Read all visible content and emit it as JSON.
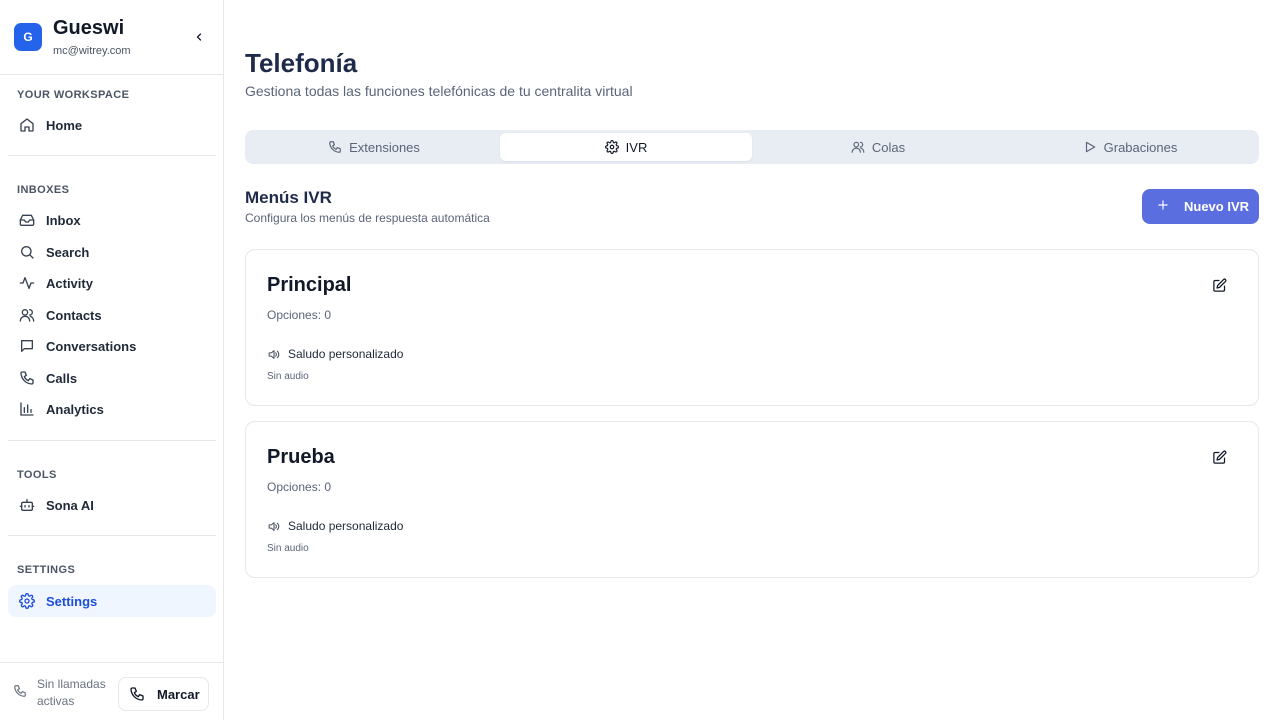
{
  "workspace": {
    "avatar_letter": "G",
    "name": "Gueswi",
    "email": "mc@witrey.com"
  },
  "sidebar": {
    "workspace_label": "YOUR WORKSPACE",
    "home": "Home",
    "inboxes_label": "INBOXES",
    "inboxes": [
      {
        "label": "Inbox",
        "icon": "inbox-icon"
      },
      {
        "label": "Search",
        "icon": "search-icon"
      },
      {
        "label": "Activity",
        "icon": "activity-icon"
      },
      {
        "label": "Contacts",
        "icon": "contacts-icon"
      },
      {
        "label": "Conversations",
        "icon": "conversations-icon"
      },
      {
        "label": "Calls",
        "icon": "phone-icon"
      },
      {
        "label": "Analytics",
        "icon": "analytics-icon"
      }
    ],
    "tools_label": "TOOLS",
    "tools": [
      {
        "label": "Sona AI",
        "icon": "bot-icon"
      }
    ],
    "settings_label": "SETTINGS",
    "settings": {
      "label": "Settings",
      "icon": "gear-icon",
      "active": true
    }
  },
  "footer": {
    "call_status": "Sin llamadas activas",
    "dial_label": "Marcar"
  },
  "page": {
    "title": "Telefonía",
    "subtitle": "Gestiona todas las funciones telefónicas de tu centralita virtual"
  },
  "tabs": [
    {
      "label": "Extensiones",
      "icon": "phone-icon",
      "active": false
    },
    {
      "label": "IVR",
      "icon": "gear-icon",
      "active": true
    },
    {
      "label": "Colas",
      "icon": "users-icon",
      "active": false
    },
    {
      "label": "Grabaciones",
      "icon": "play-icon",
      "active": false
    }
  ],
  "ivr_section": {
    "title": "Menús IVR",
    "subtitle": "Configura los menús de respuesta automática",
    "new_button": "Nuevo IVR"
  },
  "ivr_menus": [
    {
      "name": "Principal",
      "options": "Opciones: 0",
      "greeting": "Saludo personalizado",
      "audio": "Sin audio"
    },
    {
      "name": "Prueba",
      "options": "Opciones: 0",
      "greeting": "Saludo personalizado",
      "audio": "Sin audio"
    }
  ],
  "colors": {
    "accent": "#5b6ee0",
    "avatar": "#2563eb",
    "title": "#1e2a4a",
    "active_nav": "#1d4ed8"
  }
}
